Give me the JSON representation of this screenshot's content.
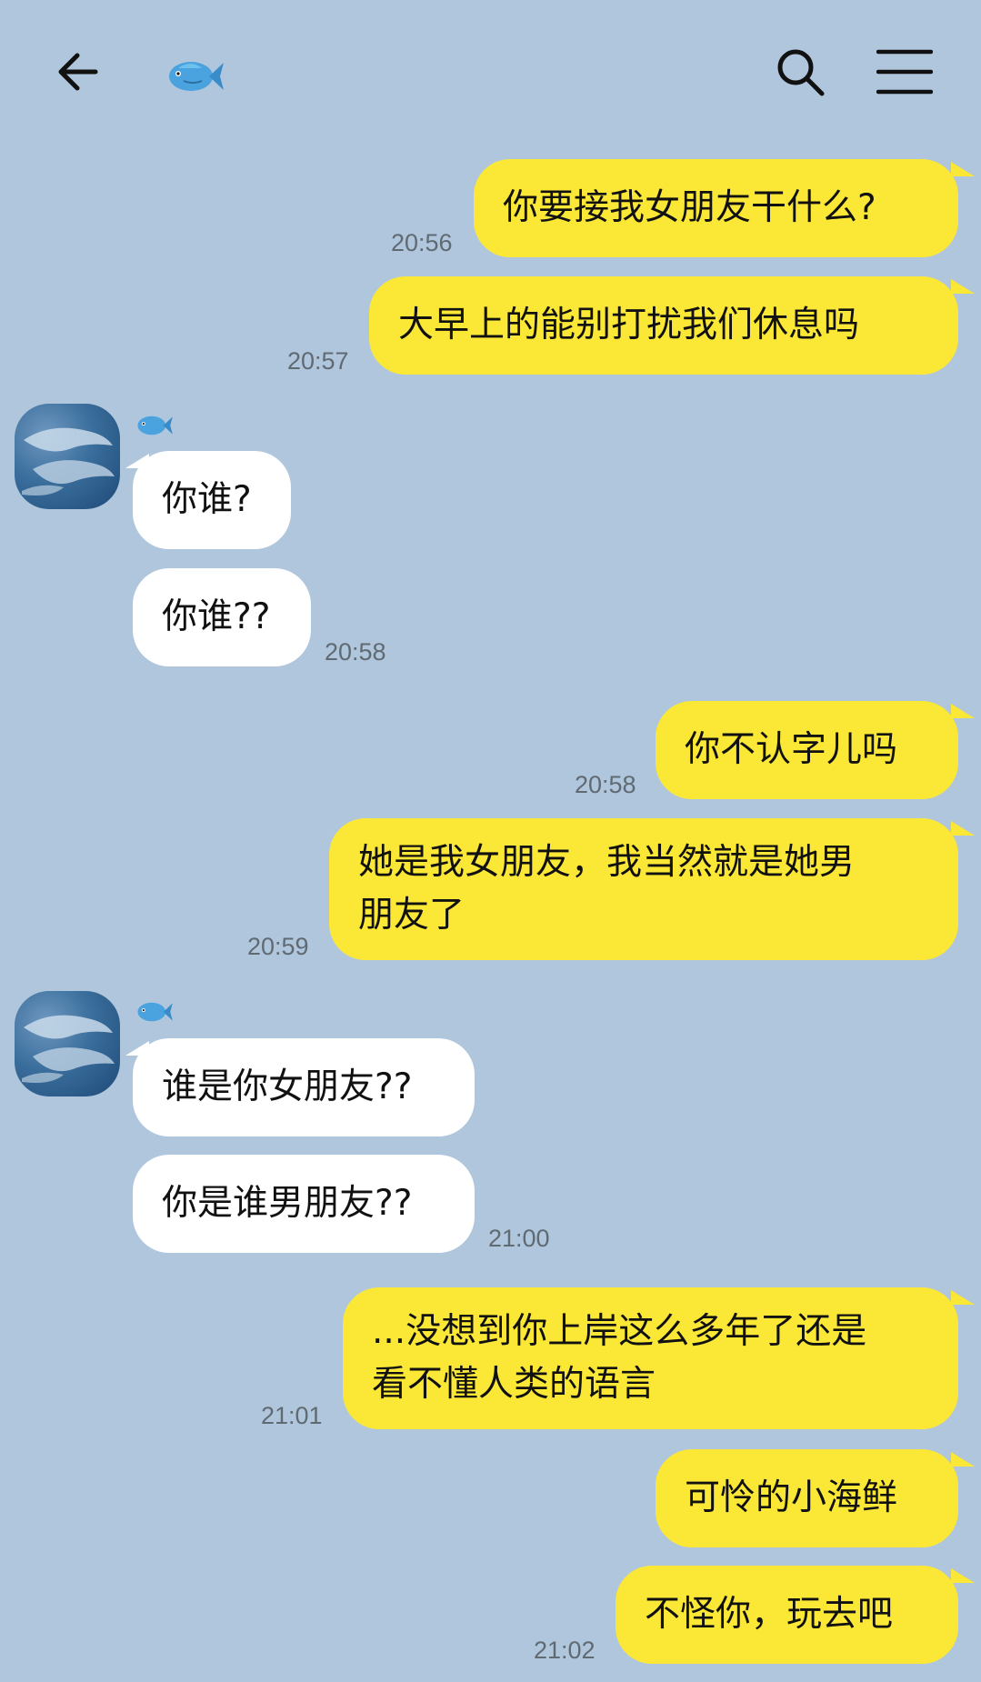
{
  "header": {
    "back_icon": "arrow-left-icon",
    "title_icon": "fish-emoji-icon",
    "search_icon": "search-icon",
    "menu_icon": "hamburger-menu-icon"
  },
  "colors": {
    "background": "#b0c6dc",
    "outgoing_bubble": "#fbe836",
    "incoming_bubble": "#ffffff",
    "timestamp": "#606a73"
  },
  "messages": [
    {
      "side": "out",
      "text": "你要接我女朋友干什么?",
      "time": "20:56"
    },
    {
      "side": "out",
      "text": "大早上的能别打扰我们休息吗",
      "time": "20:57"
    },
    {
      "side": "in",
      "text": "你谁?",
      "time": ""
    },
    {
      "side": "in",
      "text": "你谁??",
      "time": "20:58"
    },
    {
      "side": "out",
      "text": "你不认字儿吗",
      "time": "20:58"
    },
    {
      "side": "out",
      "text": "她是我女朋友，我当然就是她男\n朋友了",
      "time": "20:59"
    },
    {
      "side": "in",
      "text": "谁是你女朋友??",
      "time": ""
    },
    {
      "side": "in",
      "text": "你是谁男朋友??",
      "time": "21:00"
    },
    {
      "side": "out",
      "text": "...没想到你上岸这么多年了还是\n看不懂人类的语言",
      "time": "21:01"
    },
    {
      "side": "out",
      "text": "可怜的小海鲜",
      "time": ""
    },
    {
      "side": "out",
      "text": "不怪你，玩去吧",
      "time": "21:02"
    }
  ]
}
